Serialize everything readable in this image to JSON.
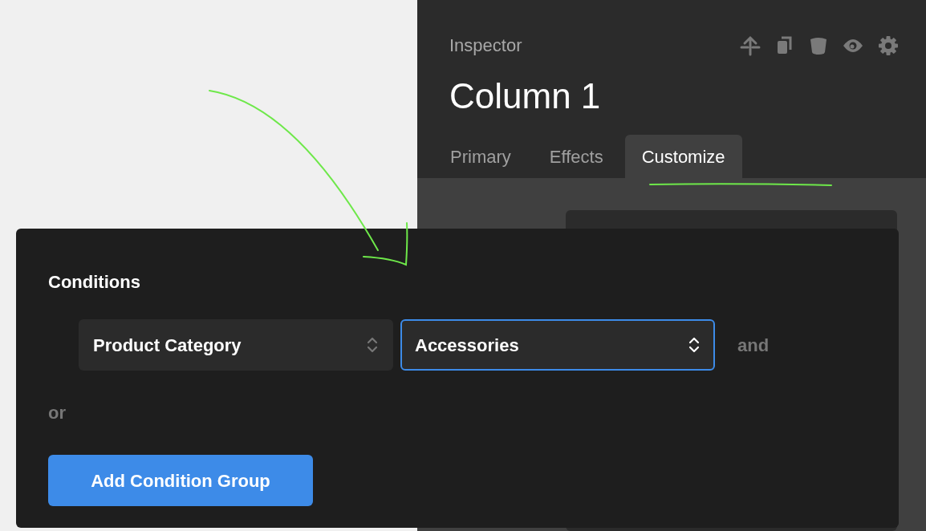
{
  "inspector": {
    "label": "Inspector",
    "title": "Column 1",
    "tabs": [
      {
        "label": "Primary",
        "selected": false
      },
      {
        "label": "Effects",
        "selected": false
      },
      {
        "label": "Customize",
        "selected": true
      }
    ]
  },
  "conditions": {
    "title": "Conditions",
    "selects": [
      {
        "value": "Product Category",
        "focused": false
      },
      {
        "value": "Accessories",
        "focused": true
      }
    ],
    "and_label": "and",
    "or_label": "or",
    "add_button": "Add Condition Group"
  }
}
